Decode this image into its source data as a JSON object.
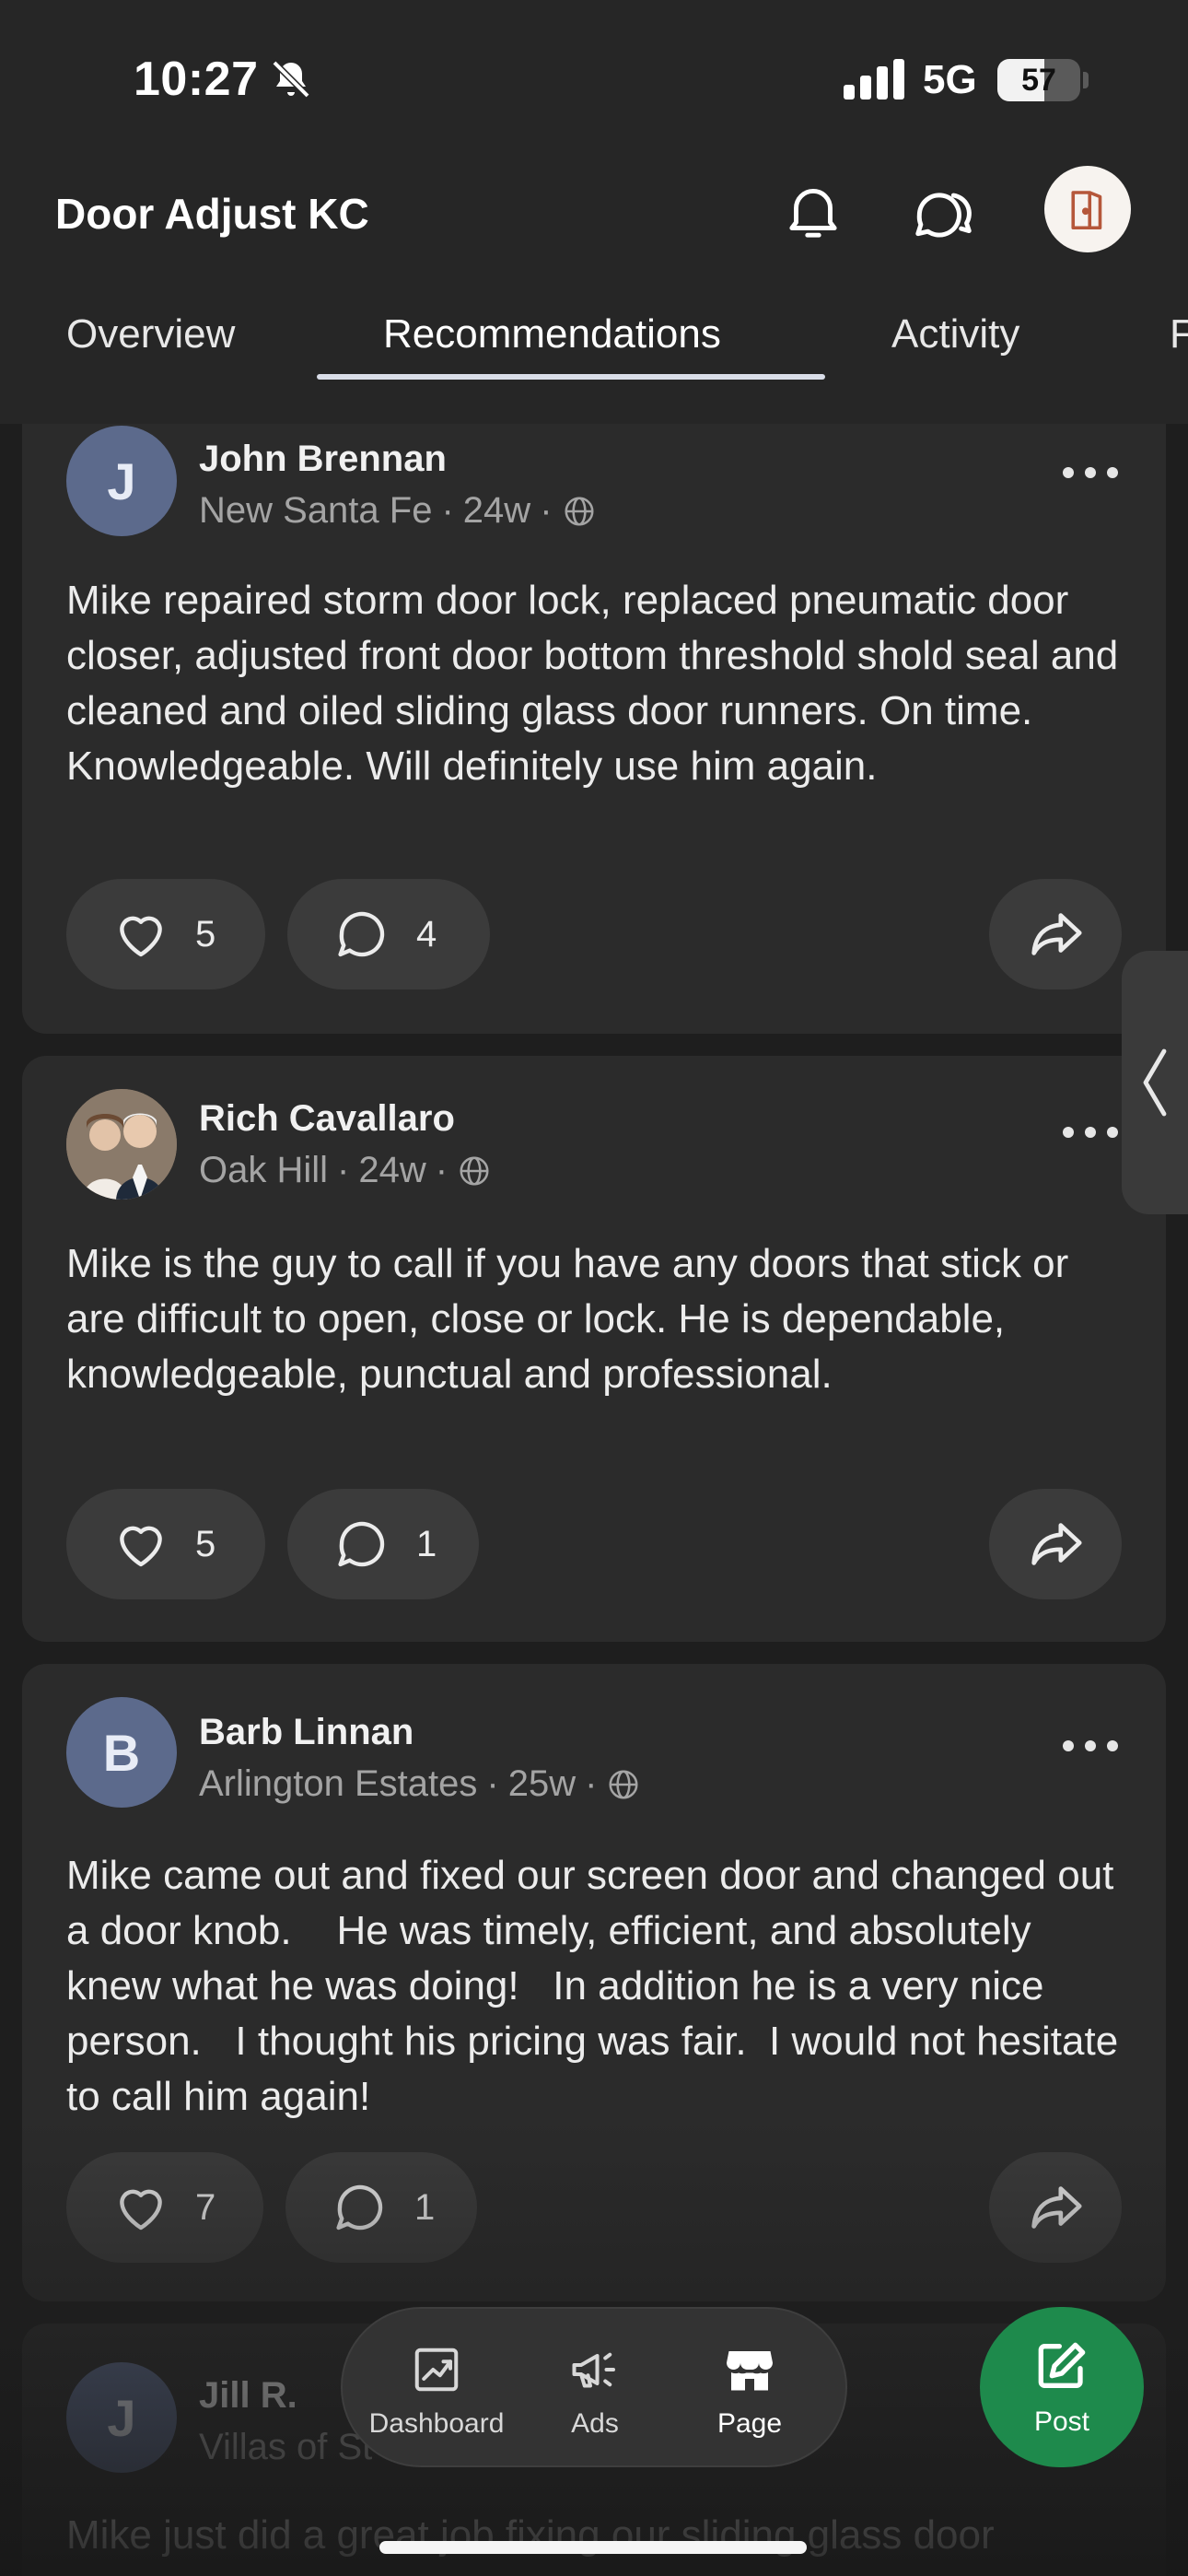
{
  "status_bar": {
    "time": "10:27",
    "network": "5G",
    "battery": "57",
    "battery_level": 0.57
  },
  "header": {
    "title": "Door Adjust KC",
    "tabs": [
      "Overview",
      "Recommendations",
      "Activity",
      "F"
    ],
    "active_tab": "Recommendations"
  },
  "posts": [
    {
      "initial": "J",
      "author": "John Brennan",
      "neighborhood": "New Santa Fe",
      "age": "24w",
      "text": "Mike repaired storm door lock, replaced pneumatic door closer, adjusted front door bottom threshold shold seal and cleaned and oiled sliding glass door runners. On time. Knowledgeable.  Will definitely use him again.",
      "likes": "5",
      "comments": "4"
    },
    {
      "initial": "",
      "author": "Rich Cavallaro",
      "neighborhood": "Oak Hill",
      "age": "24w",
      "text": "Mike is the guy to call if you have any doors that stick or are difficult to open, close or lock. He is dependable, knowledgeable, punctual and professional.",
      "likes": "5",
      "comments": "1"
    },
    {
      "initial": "B",
      "author": "Barb Linnan",
      "neighborhood": "Arlington Estates",
      "age": "25w",
      "text": "Mike came out and fixed our screen door and changed out a door knob.    He was timely, efficient, and absolutely knew what he was doing!   In addition he is a very nice person.   I thought his pricing was fair.  I would not hesitate to call him again!",
      "likes": "7",
      "comments": "1"
    },
    {
      "initial": "J",
      "author": "Jill R.",
      "neighborhood": "Villas of St",
      "text": "Mike just did a great job fixing our sliding glass door"
    }
  ],
  "bottom_nav": {
    "dashboard": "Dashboard",
    "ads": "Ads",
    "page": "Page",
    "post": "Post"
  },
  "colors": {
    "background": "#1e1e1e",
    "card": "#2b2b2b",
    "pill": "#3b3b3b",
    "post_button": "#1e8a4c",
    "avatar": "#5c6a8c"
  },
  "icons": [
    "bell-icon",
    "chat-icon",
    "door-logo-icon",
    "globe-icon",
    "more-icon",
    "heart-icon",
    "comment-icon",
    "share-icon",
    "dashboard-icon",
    "megaphone-icon",
    "storefront-icon",
    "edit-icon"
  ]
}
